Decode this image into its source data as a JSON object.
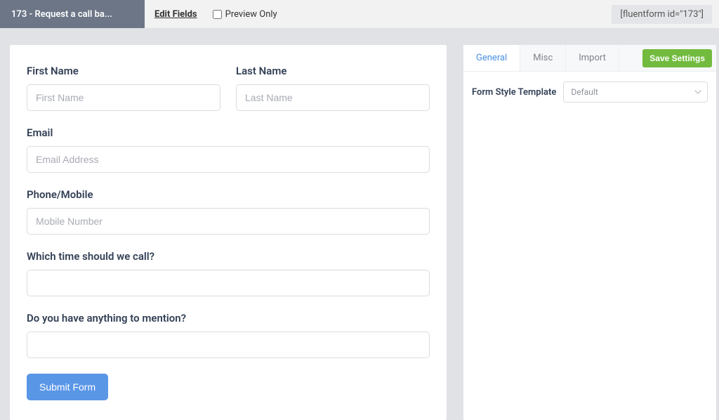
{
  "topbar": {
    "title": "173 - Request a call ba...",
    "edit_link": "Edit Fields",
    "preview_label": "Preview Only",
    "shortcode": "[fluentform id=\"173\"]"
  },
  "form": {
    "first_name_label": "First Name",
    "first_name_placeholder": "First Name",
    "last_name_label": "Last Name",
    "last_name_placeholder": "Last Name",
    "email_label": "Email",
    "email_placeholder": "Email Address",
    "phone_label": "Phone/Mobile",
    "phone_placeholder": "Mobile Number",
    "time_label": "Which time should we call?",
    "mention_label": "Do you have anything to mention?",
    "submit_label": "Submit Form"
  },
  "side": {
    "tabs": {
      "general": "General",
      "misc": "Misc",
      "import": "Import"
    },
    "save_label": "Save Settings",
    "style_label": "Form Style Template",
    "style_value": "Default"
  }
}
